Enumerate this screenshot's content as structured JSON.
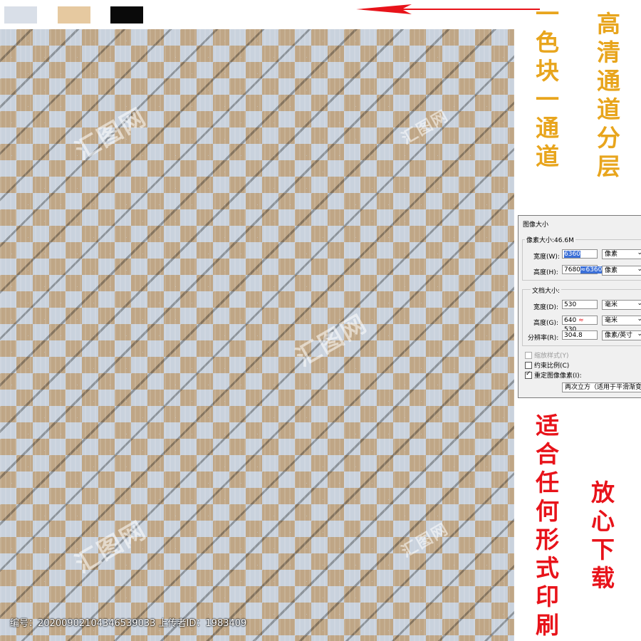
{
  "swatches": [
    "#d9dfe8",
    "#e6c9a0",
    "#0a0a0a"
  ],
  "colors": {
    "gold": "#e8a51d",
    "red": "#e8131a"
  },
  "texts": {
    "col1": "一色块一通道",
    "col2": "高清通道分层",
    "col3": "适合任何形式印刷",
    "col4": "放心下载"
  },
  "footer": "编号：20200902104346539033 上传者ID：1983409",
  "dialog": {
    "title": "图像大小",
    "pixel_dims": "像素大小:46.6M",
    "width_label": "宽度(W):",
    "width_value": "6360",
    "width_unit": "像素",
    "height_label": "高度(H):",
    "height_value_a": "7680",
    "height_value_b": "6360",
    "height_unit": "像素",
    "doc_size": "文档大小:",
    "doc_width_label": "宽度(D):",
    "doc_width_value": "530",
    "doc_width_unit": "毫米",
    "doc_height_label": "高度(G):",
    "doc_height_value": "640",
    "doc_height_value_b": "530",
    "doc_height_unit": "毫米",
    "res_label": "分辨率(R):",
    "res_value": "304.8",
    "res_unit": "像素/英寸",
    "scale_styles": "缩放样式(Y)",
    "constrain": "约束比例(C)",
    "resample": "重定图像像素(I):",
    "resample_method": "两次立方（适用于平滑渐变"
  }
}
